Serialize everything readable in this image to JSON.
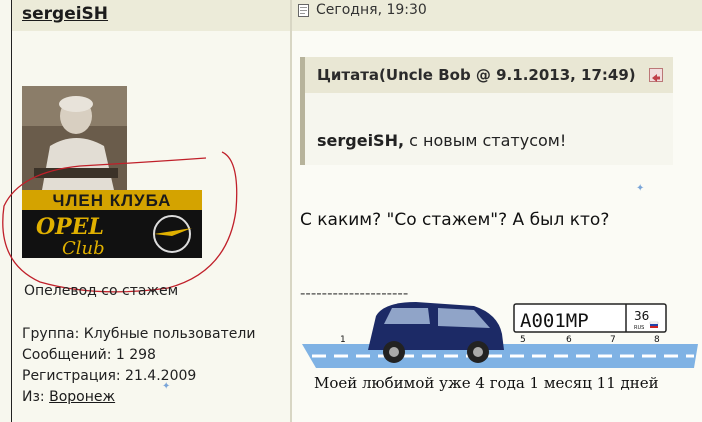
{
  "author": {
    "name": "sergeiSH",
    "avatar_caption": "ЧЛЕН КЛУБА",
    "avatar_logo_top": "OPEL",
    "avatar_logo_bottom": "Club",
    "status": "Опелевод со стажем",
    "group_label": "Группа: Клубные пользователи",
    "posts_label": "Сообщений: 1 298",
    "registration_label": "Регистрация: 21.4.2009",
    "from_label": "Из:",
    "from_value": "Воронеж"
  },
  "post": {
    "date": "Сегодня, 19:30",
    "quote_title": "Цитата(Uncle Bob @ 9.1.2013, 17:49)",
    "quote_name": "sergeiSH,",
    "quote_rest": " с новым статусом!",
    "reply": "С каким? \"Со стажем\"? А был кто?",
    "separator": "--------------------",
    "banner": {
      "plate_number": "А001МР",
      "plate_region": "36",
      "plate_rus": "RUS",
      "scale_marks": [
        "1",
        "5",
        "6",
        "7",
        "8"
      ],
      "caption": "Моей любимой уже 4 года 1 месяц 11 дней"
    }
  },
  "colors": {
    "header_bg": "#ecebd9",
    "annotation_red": "#c0202a",
    "plus_blue": "#7aa5d8"
  }
}
